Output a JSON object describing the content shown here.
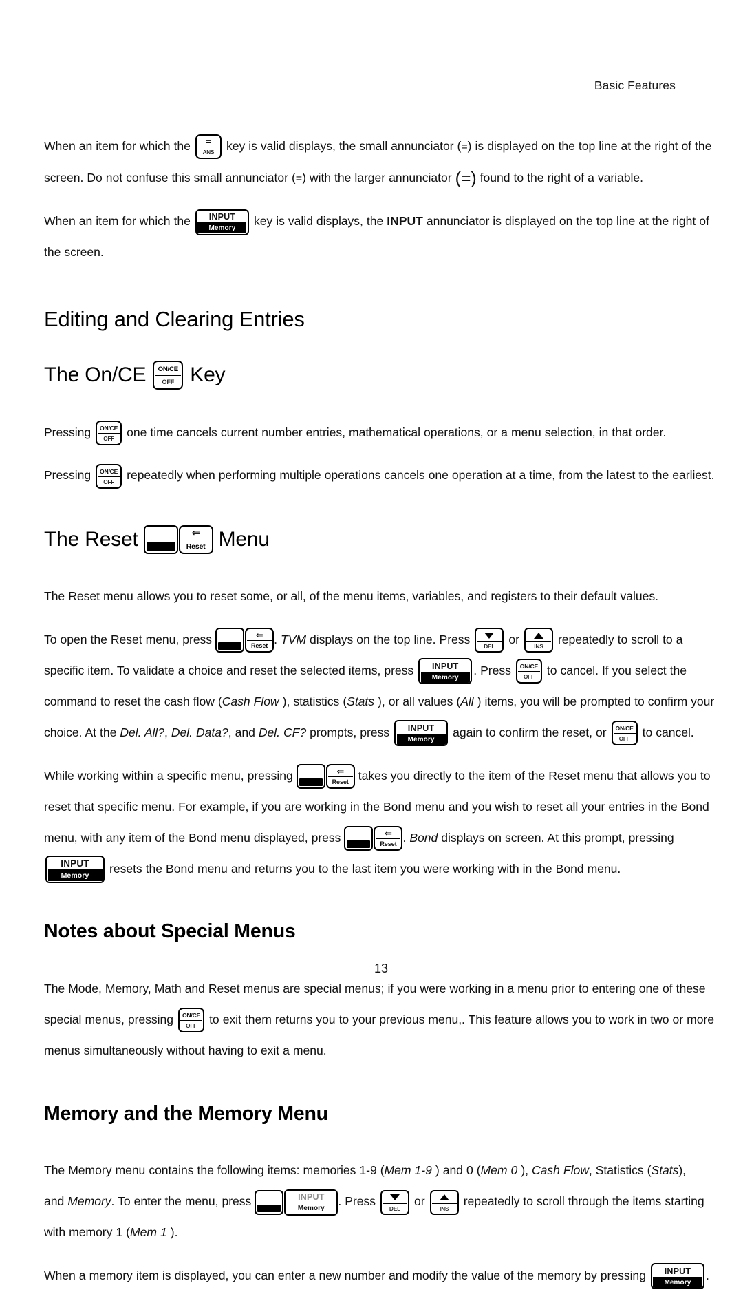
{
  "header": {
    "running_head": "Basic Features"
  },
  "folio": {
    "page_number": "13"
  },
  "keys": {
    "ans": {
      "top": "=",
      "bottom": "ANS"
    },
    "input": {
      "top": "INPUT",
      "bottom": "Memory"
    },
    "once": {
      "top": "ON/CE",
      "bottom": "OFF"
    },
    "second": {
      "top": "",
      "bottom": ""
    },
    "reset": {
      "top": "⇐",
      "bottom": "Reset"
    },
    "del": {
      "top": "▼",
      "bottom": "DEL"
    },
    "ins": {
      "top": "▲",
      "bottom": "INS"
    }
  },
  "intro": {
    "p1_a": "When an item for which the",
    "p1_b": "key is valid displays, the small annunciator (",
    "p1_ann1": "=",
    "p1_c": ") is displayed on the top line at the right of the screen. Do not confuse this small annunciator (",
    "p1_ann2": "=",
    "p1_d": ") with the larger annunciator",
    "p1_ann3": "(=)",
    "p1_e": "found to the right of a variable.",
    "p2_a": "When an item for which the",
    "p2_b": "key is valid displays, the",
    "p2_strong": "INPUT",
    "p2_c": "annunciator is displayed on the top line at the right of the screen."
  },
  "section_editing": {
    "heading": "Editing and Clearing Entries",
    "subheading_pre": "The On/CE",
    "subheading_post": "Key",
    "p1_a": "Pressing",
    "p1_b": "one time cancels current number entries, mathematical operations, or a menu selection, in that order.",
    "p2_a": "Pressing",
    "p2_b": "repeatedly when performing multiple operations cancels one operation at a time, from the latest to the earliest."
  },
  "section_reset": {
    "subheading_pre": "The Reset",
    "subheading_post": "Menu",
    "p1": "The Reset menu allows you to reset some, or all, of the menu items, variables, and registers to their default values.",
    "p2_a": "To open the Reset menu, press",
    "p2_b": ".",
    "p2_tvm": "TVM",
    "p2_c": "displays on the top line. Press",
    "p2_or": "or",
    "p2_d": "repeatedly to scroll to a specific item. To validate a choice and reset the selected items, press",
    "p2_e": ". Press",
    "p2_f": "to cancel. If you select the command to reset the cash flow (",
    "p2_cashflow": "Cash Flow",
    "p2_g": "), statistics (",
    "p2_stats": "Stats",
    "p2_h": "), or all values (",
    "p2_all": "All",
    "p2_i": ") items, you will be prompted to confirm your choice. At the",
    "p2_delall": "Del. All?",
    "p2_comma1": ",",
    "p2_deldata": "Del. Data?",
    "p2_comma2": ", and",
    "p2_delcf": "Del. CF?",
    "p2_j": "prompts, press",
    "p2_k": "again to confirm the reset, or",
    "p2_l": "to cancel.",
    "p3_a": "While working within a specific menu, pressing",
    "p3_b": "takes you directly to the item of the Reset menu that allows you to reset that specific menu. For example, if you are working in the Bond menu and you wish to reset all your entries in the Bond menu, with any item of the Bond menu displayed, press",
    "p3_c": ".",
    "p3_bond": "Bond",
    "p3_d": "displays on screen. At this prompt, pressing",
    "p3_e": "resets the Bond menu and returns you to the last item you were working with in the Bond menu."
  },
  "section_notes": {
    "heading": "Notes about Special Menus",
    "p1_a": "The Mode, Memory, Math and Reset menus are special menus; if you were working in a menu prior to entering one of these special menus, pressing",
    "p1_b": "to exit them returns you to your previous menu,. This feature allows you to work in two or more menus simultaneously without having to exit a menu."
  },
  "section_memory": {
    "heading": "Memory and the Memory Menu",
    "p1_a": "The Memory menu contains the following items: memories 1-9 (",
    "p1_mem19": "Mem 1-9",
    "p1_b": ") and 0 (",
    "p1_mem0": "Mem 0",
    "p1_c": "),",
    "p1_cashflow": "Cash Flow",
    "p1_d": ", Statistics (",
    "p1_stats": "Stats",
    "p1_e": "), and",
    "p1_memory": "Memory",
    "p1_f": ". To enter the menu, press",
    "p1_g": ". Press",
    "p1_or": "or",
    "p1_h": "repeatedly to scroll through the items starting with memory 1 (",
    "p1_mem1": "Mem 1",
    "p1_i": ").",
    "p2_a": "When a memory item is displayed, you can enter a new number and modify the value of the memory by pressing",
    "p2_b": "."
  }
}
